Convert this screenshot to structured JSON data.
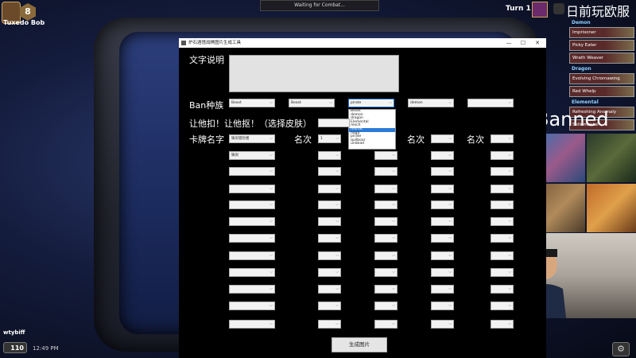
{
  "game": {
    "player_name_top": "Tuxedo Bob",
    "tavern_tier": "8",
    "status_text": "Waiting for Combat...",
    "turn_label": "Turn 1",
    "channel_title": "日前玩欧服",
    "player_name_bottom": "wtybiff",
    "coins": "110",
    "clock": "12:49 PM",
    "gear_icon": "⚙"
  },
  "tribes": [
    {
      "header": "Demon",
      "cards": [
        "Imprisoner",
        "Picky Eater",
        "Wrath Weaver"
      ]
    },
    {
      "header": "Dragon",
      "cards": [
        "Evolving Chromawing",
        "Red Whelp"
      ]
    },
    {
      "header": "Elemental",
      "cards": [
        "Refreshing Anomaly",
        "Sellemental"
      ]
    }
  ],
  "banned_label": "Banned",
  "app": {
    "title": "炉石酒馆战棋图片生成工具",
    "minimize": "—",
    "maximize": "☐",
    "close": "✕",
    "labels": {
      "description": "文字说明",
      "ban_tribes": "Ban种族",
      "let_him": "让他扣！让他抠！（选择皮肤）",
      "card_name": "卡牌名字",
      "rank": "名次"
    },
    "ban_combos": [
      "Beast",
      "Beast",
      "pirate",
      "demon",
      ""
    ],
    "dropdown_items": [
      "Beast",
      "demon",
      "dragon",
      "Elemental",
      "mech",
      "murloc",
      "naga",
      "pirate",
      "quilboar",
      "undead"
    ],
    "dropdown_selected_index": 5,
    "card_combos": [
      "铸剑冒险者",
      "铸剑"
    ],
    "rank_first": "1",
    "generate_label": "生成图片"
  }
}
